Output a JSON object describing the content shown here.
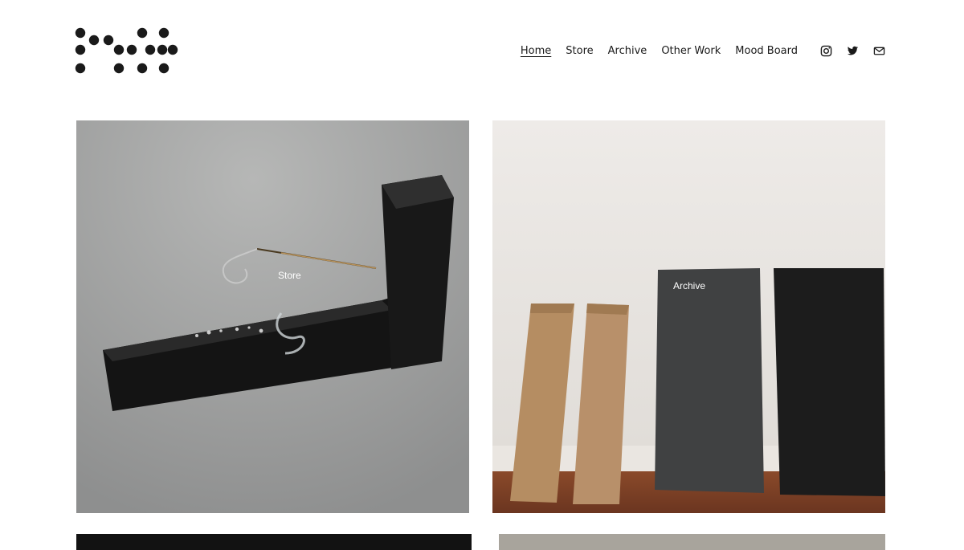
{
  "header": {
    "nav": [
      {
        "label": "Home",
        "active": true
      },
      {
        "label": "Store",
        "active": false
      },
      {
        "label": "Archive",
        "active": false
      },
      {
        "label": "Other Work",
        "active": false
      },
      {
        "label": "Mood Board",
        "active": false
      }
    ],
    "social": [
      "instagram-icon",
      "twitter-icon",
      "mail-icon"
    ]
  },
  "tiles": [
    {
      "label": "Store",
      "image": "black stone incense holder on grey surface"
    },
    {
      "label": "Archive",
      "image": "cardboard boxes and dark panels leaning on wall"
    },
    {
      "label": "",
      "image": "dark photo (partially visible)"
    },
    {
      "label": "",
      "image": "grey photo (partially visible)"
    }
  ],
  "colors": {
    "text": "#1a1a1a",
    "background": "#ffffff",
    "label": "#ffffff"
  }
}
